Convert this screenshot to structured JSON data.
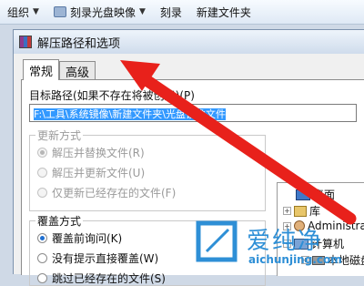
{
  "toolbar": {
    "items": [
      {
        "label": "组织",
        "has_caret": true
      },
      {
        "label": "刻录光盘映像",
        "has_caret": true
      },
      {
        "label": "刻录",
        "has_caret": false
      },
      {
        "label": "新建文件夹",
        "has_caret": false
      }
    ]
  },
  "dialog": {
    "title": "解压路径和选项",
    "tabs": [
      {
        "label": "常规",
        "active": true
      },
      {
        "label": "高级",
        "active": false
      }
    ],
    "path": {
      "label": "目标路径(如果不存在将被创建)(P)",
      "value": "F:\\工具\\系统镜像\\新建文件夹\\光盘镜像文件"
    },
    "update_group": {
      "title": "更新方式",
      "options": [
        {
          "label": "解压并替换文件(R)",
          "selected": true
        },
        {
          "label": "解压并更新文件(U)",
          "selected": false
        },
        {
          "label": "仅更新已经存在的文件(F)",
          "selected": false
        }
      ]
    },
    "overwrite_group": {
      "title": "覆盖方式",
      "options": [
        {
          "label": "覆盖前询问(K)",
          "selected": true
        },
        {
          "label": "没有提示直接覆盖(W)",
          "selected": false
        },
        {
          "label": "跳过已经存在的文件(S)",
          "selected": false
        }
      ]
    },
    "tree": {
      "items": [
        {
          "label": "桌面",
          "expander": ""
        },
        {
          "label": "库",
          "expander": "+"
        },
        {
          "label": "Administrator",
          "expander": "+"
        },
        {
          "label": "计算机",
          "expander": "-"
        },
        {
          "label": "本地磁盘",
          "expander": "+"
        }
      ]
    }
  },
  "watermark": {
    "cn_text": "爱纯净",
    "url": "aichunjing.com"
  },
  "colors": {
    "arrow": "#e8211b",
    "selection": "#3399ff",
    "watermark": "#2e8fd6"
  }
}
